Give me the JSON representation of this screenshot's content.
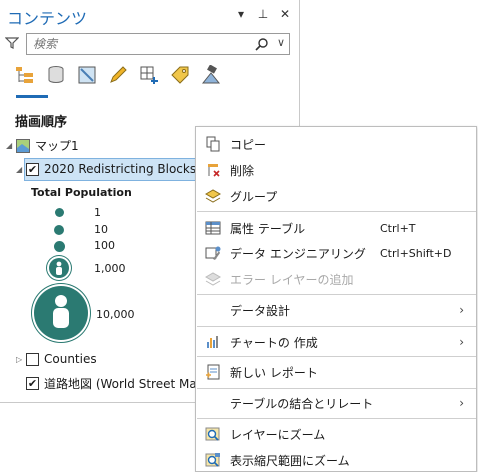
{
  "pane": {
    "title": "コンテンツ",
    "controls": [
      "chevron-down-icon",
      "pin-icon",
      "close-icon"
    ],
    "search": {
      "placeholder": "検索"
    },
    "section_title": "描画順序",
    "map_name": "マップ1",
    "layers": [
      {
        "name": "2020 Redistricting Blocks",
        "checked": true,
        "expanded": true,
        "selected": true
      },
      {
        "name": "Counties",
        "checked": false,
        "expanded": false
      },
      {
        "name": "道路地図 (World Street Map)",
        "checked": true
      }
    ],
    "legend": {
      "title": "Total Population",
      "classes": [
        "1",
        "10",
        "100",
        "1,000",
        "10,000"
      ],
      "color": "#2b7a72"
    }
  },
  "menu": {
    "items": [
      {
        "label": "コピー",
        "icon": "copy-icon"
      },
      {
        "label": "削除",
        "icon": "remove-icon"
      },
      {
        "label": "グループ",
        "icon": "group-icon"
      },
      {
        "label": "属性 テーブル",
        "shortcut": "Ctrl+T",
        "icon": "table-icon"
      },
      {
        "label": "データ エンジニアリング",
        "shortcut": "Ctrl+Shift+D",
        "icon": "data-engineering-icon"
      },
      {
        "label": "エラー レイヤーの追加",
        "icon": "error-layer-icon",
        "disabled": true
      },
      {
        "label": "データ設計",
        "submenu": true
      },
      {
        "label": "チャートの 作成",
        "icon": "chart-icon",
        "submenu": true
      },
      {
        "label": "新しい レポート",
        "icon": "report-icon"
      },
      {
        "label": "テーブルの結合とリレート",
        "submenu": true
      },
      {
        "label": "レイヤーにズーム",
        "icon": "zoom-layer-icon"
      },
      {
        "label": "表示縮尺範囲にズーム",
        "icon": "zoom-scale-icon"
      }
    ]
  }
}
